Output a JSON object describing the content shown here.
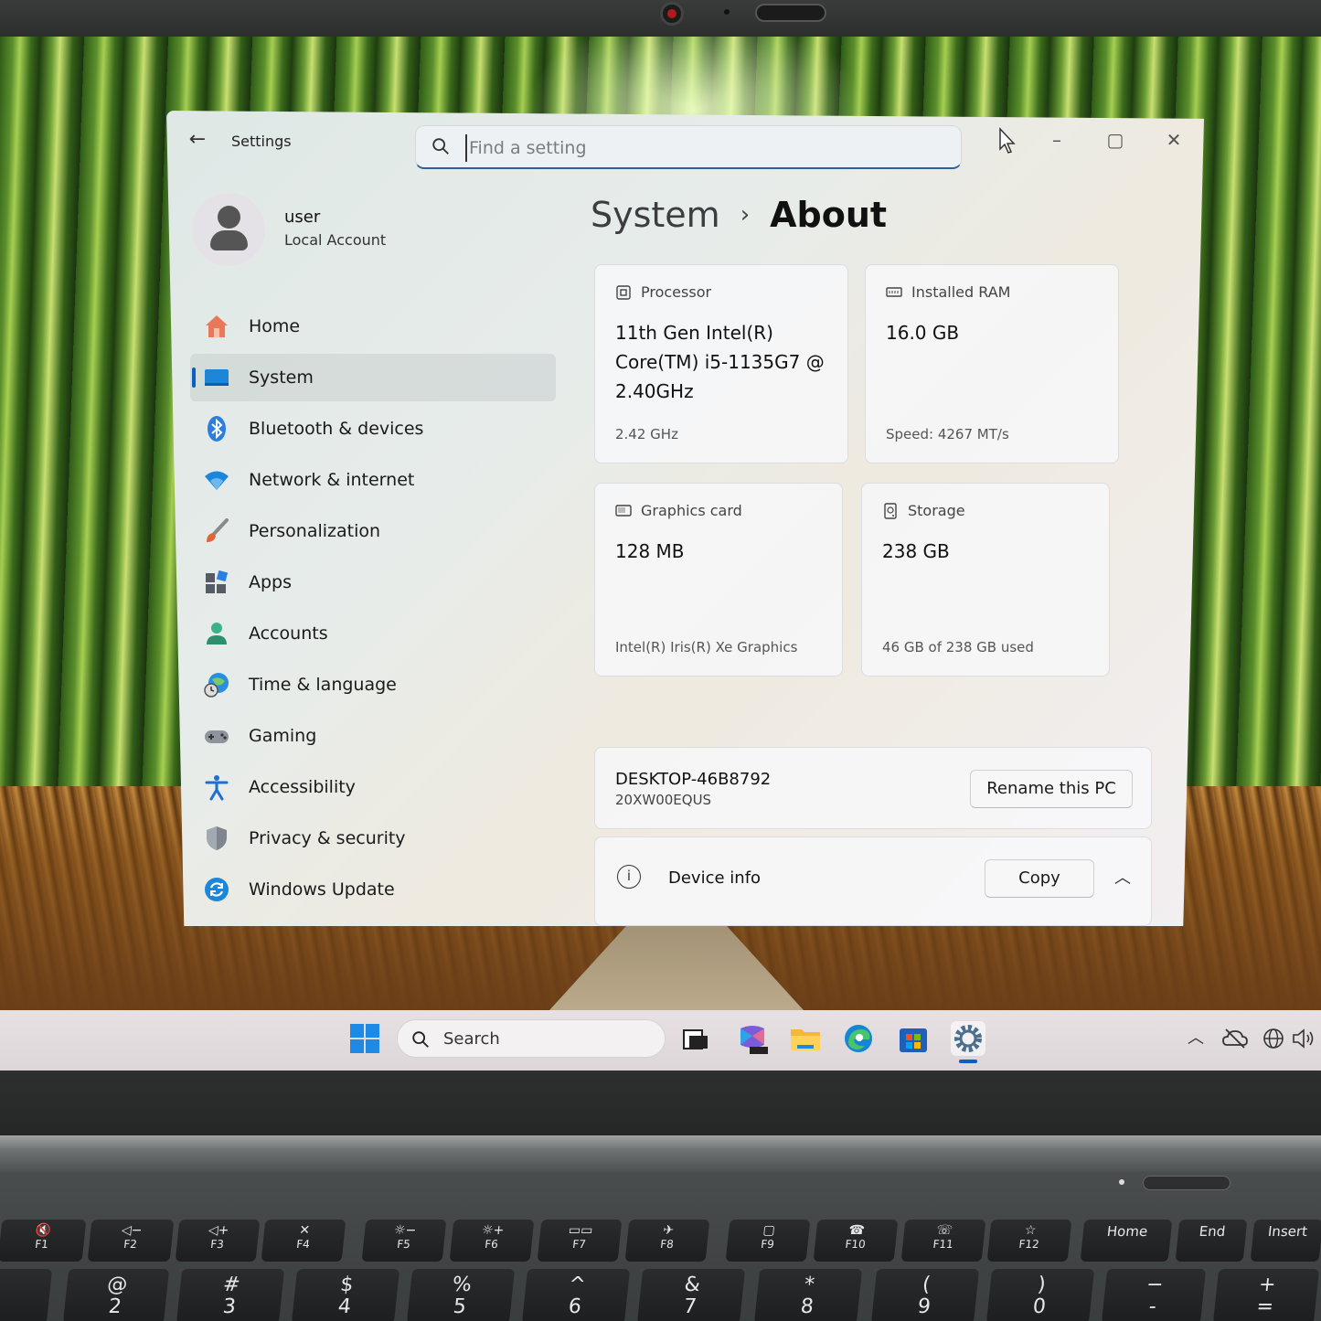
{
  "window": {
    "app_title": "Settings",
    "search_placeholder": "Find a setting"
  },
  "profile": {
    "name": "user",
    "account_type": "Local Account"
  },
  "nav": [
    {
      "label": "Home",
      "icon": "home-icon"
    },
    {
      "label": "System",
      "icon": "system-icon",
      "active": true
    },
    {
      "label": "Bluetooth & devices",
      "icon": "bluetooth-icon"
    },
    {
      "label": "Network & internet",
      "icon": "wifi-icon"
    },
    {
      "label": "Personalization",
      "icon": "brush-icon"
    },
    {
      "label": "Apps",
      "icon": "apps-icon"
    },
    {
      "label": "Accounts",
      "icon": "accounts-icon"
    },
    {
      "label": "Time & language",
      "icon": "globe-clock-icon"
    },
    {
      "label": "Gaming",
      "icon": "gamepad-icon"
    },
    {
      "label": "Accessibility",
      "icon": "accessibility-icon"
    },
    {
      "label": "Privacy & security",
      "icon": "shield-icon"
    },
    {
      "label": "Windows Update",
      "icon": "update-icon"
    }
  ],
  "breadcrumb": {
    "parent": "System",
    "separator": "›",
    "current": "About"
  },
  "specs": {
    "processor": {
      "label": "Processor",
      "value_lines": [
        "11th Gen Intel(R)",
        "Core(TM) i5-1135G7 @",
        "2.40GHz"
      ],
      "sub": "2.42 GHz"
    },
    "ram": {
      "label": "Installed RAM",
      "value": "16.0 GB",
      "sub": "Speed: 4267 MT/s"
    },
    "graphics": {
      "label": "Graphics card",
      "value": "128 MB",
      "sub": "Intel(R) Iris(R) Xe Graphics"
    },
    "storage": {
      "label": "Storage",
      "value": "238 GB",
      "sub": "46 GB of 238 GB used"
    }
  },
  "device": {
    "name": "DESKTOP-46B8792",
    "model": "20XW00EQUS",
    "rename_label": "Rename this PC"
  },
  "device_info": {
    "label": "Device info",
    "copy_label": "Copy"
  },
  "taskbar": {
    "search_label": "Search",
    "apps": [
      "task-view-icon",
      "m365-copilot-icon",
      "file-explorer-icon",
      "edge-icon",
      "microsoft-store-icon",
      "settings-icon"
    ],
    "tray": [
      "chevron-up-icon",
      "cloud-off-icon",
      "network-globe-icon",
      "speaker-icon"
    ]
  },
  "keyboard": {
    "function_keys": [
      {
        "icon": "🔇",
        "label": "F1"
      },
      {
        "icon": "◁−",
        "label": "F2"
      },
      {
        "icon": "◁+",
        "label": "F3"
      },
      {
        "icon": "✕",
        "label": "F4"
      },
      {
        "icon": "☼−",
        "label": "F5"
      },
      {
        "icon": "☼+",
        "label": "F6"
      },
      {
        "icon": "▭▭",
        "label": "F7"
      },
      {
        "icon": "✈",
        "label": "F8"
      },
      {
        "icon": "▢",
        "label": "F9"
      },
      {
        "icon": "☎",
        "label": "F10"
      },
      {
        "icon": "☏",
        "label": "F11"
      },
      {
        "icon": "☆",
        "label": "F12"
      }
    ],
    "nav_keys": [
      "Home",
      "End",
      "Insert"
    ],
    "number_keys": [
      {
        "top": "@",
        "bottom": "2"
      },
      {
        "top": "#",
        "bottom": "3"
      },
      {
        "top": "$",
        "bottom": "4"
      },
      {
        "top": "%",
        "bottom": "5"
      },
      {
        "top": "^",
        "bottom": "6"
      },
      {
        "top": "&",
        "bottom": "7"
      },
      {
        "top": "*",
        "bottom": "8"
      },
      {
        "top": "(",
        "bottom": "9"
      },
      {
        "top": ")",
        "bottom": "0"
      },
      {
        "top": "−",
        "bottom": "-"
      },
      {
        "top": "+",
        "bottom": "="
      }
    ]
  },
  "colors": {
    "accent": "#0b5fc4"
  }
}
